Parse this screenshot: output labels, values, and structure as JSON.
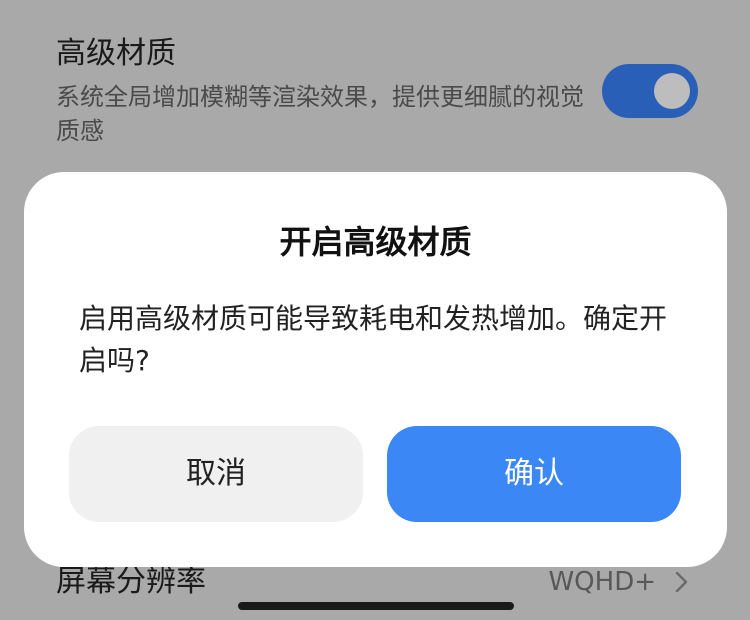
{
  "setting": {
    "title": "高级材质",
    "description": "系统全局增加模糊等渲染效果，提供更细腻的视觉质感",
    "toggle_on": true
  },
  "resolution": {
    "label": "屏幕分辨率",
    "value": "WQHD+"
  },
  "dialog": {
    "title": "开启高级材质",
    "message": "启用高级材质可能导致耗电和发热增加。确定开启吗?",
    "cancel_label": "取消",
    "confirm_label": "确认"
  },
  "colors": {
    "accent": "#3a87f5",
    "toggle_on": "#2a5fb8",
    "background_dim": "#a9a9a9"
  },
  "icons": {
    "chevron": "chevron-right-icon"
  }
}
